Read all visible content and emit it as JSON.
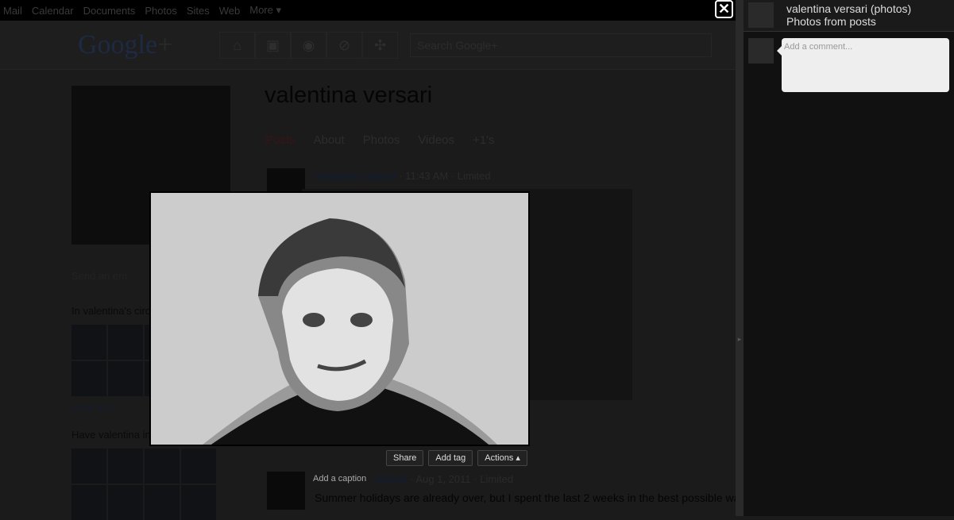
{
  "topbar": {
    "items": [
      "Mail",
      "Calendar",
      "Documents",
      "Photos",
      "Sites",
      "Web",
      "More ▾"
    ]
  },
  "header": {
    "logo": "Google",
    "logo_plus": "+",
    "search_placeholder": "Search Google+",
    "nav_icons": [
      "home-icon",
      "photos-icon",
      "profile-icon",
      "circles-icon",
      "games-icon"
    ]
  },
  "profile": {
    "name": "valentina versari",
    "tabs": [
      "Posts",
      "About",
      "Photos",
      "Videos",
      "+1's"
    ],
    "send_email": "Send an em",
    "in_circles": "In valentina's circ",
    "view_all": "View all >",
    "have_in_circles": "Have valentina in"
  },
  "posts": [
    {
      "author": "valentina versari",
      "time": "11:43 AM",
      "visibility": "Limited"
    },
    {
      "author_partial": "versari",
      "time": "Aug 1, 2011",
      "visibility": "Limited",
      "text": "Summer holidays are already over, but I spent the last 2 weeks in the best possible way :)"
    }
  ],
  "viewer": {
    "share": "Share",
    "add_tag": "Add tag",
    "actions": "Actions ▴",
    "caption_placeholder": "Add a caption"
  },
  "panel": {
    "title": "valentina versari (photos)",
    "subtitle": "Photos from posts",
    "comment_placeholder": "Add a comment..."
  }
}
